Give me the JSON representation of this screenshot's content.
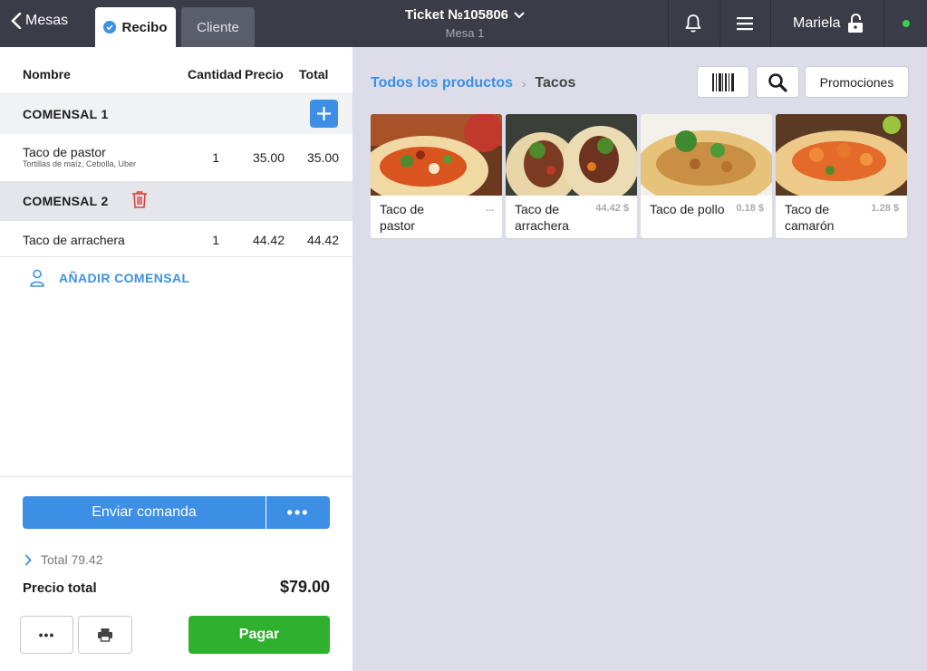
{
  "topbar": {
    "back_label": "Mesas",
    "tabs": [
      {
        "label": "Recibo",
        "active": true
      },
      {
        "label": "Cliente",
        "active": false
      }
    ],
    "ticket_title": "Ticket №105806",
    "ticket_subtitle": "Mesa 1",
    "user_name": "Mariela",
    "status_color": "#37d24a",
    "icons": [
      "chevron-left-icon",
      "check-circle-icon",
      "chevron-down-icon",
      "bell-icon",
      "menu-icon",
      "unlock-icon"
    ]
  },
  "receipt": {
    "columns": [
      "Nombre",
      "Cantidad",
      "Precio",
      "Total"
    ],
    "comensales": [
      {
        "label": "COMENSAL 1",
        "items": [
          {
            "name": "Taco de pastor",
            "modifiers": "Tortillas de maíz, Cebolla, Uber",
            "qty": "1",
            "price": "35.00",
            "total": "35.00"
          }
        ]
      },
      {
        "label": "COMENSAL 2",
        "items": [
          {
            "name": "Taco de arrachera",
            "modifiers": "",
            "qty": "1",
            "price": "44.42",
            "total": "44.42"
          }
        ]
      }
    ],
    "add_comensal_label": "AÑADIR COMENSAL",
    "send_button": "Enviar comanda",
    "more_button": "•••",
    "total_summary": "Total 79.42",
    "precio_total_label": "Precio total",
    "precio_total_value": "$79.00",
    "bottom_more": "•••",
    "pay_button": "Pagar"
  },
  "catalog": {
    "breadcrumb": {
      "root": "Todos los productos",
      "separator": "›",
      "current": "Tacos"
    },
    "promotions_button": "Promociones",
    "products": [
      {
        "name": "Taco de pastor",
        "price": "..."
      },
      {
        "name": "Taco de arrachera",
        "price": "44.42 $"
      },
      {
        "name": "Taco de pollo",
        "price": "0.18 $"
      },
      {
        "name": "Taco de camarón",
        "price": "1.28 $"
      }
    ]
  },
  "colors": {
    "accent": "#3d8fe6",
    "pay": "#2fb12f",
    "topbar": "#3a3d48",
    "danger": "#e0403a"
  }
}
